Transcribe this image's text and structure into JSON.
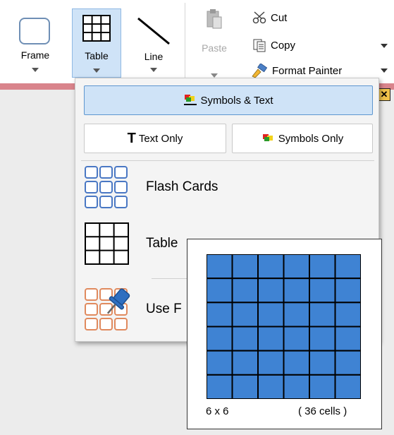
{
  "ribbon": {
    "frame_label": "Frame",
    "table_label": "Table",
    "line_label": "Line",
    "paste_label": "Paste",
    "cut_label": "Cut",
    "copy_label": "Copy",
    "format_painter_label": "Format Painter"
  },
  "menu": {
    "symbols_text_label": "Symbols & Text",
    "text_only_label": "Text Only",
    "symbols_only_label": "Symbols Only",
    "flash_cards_label": "Flash Cards",
    "table_label": "Table",
    "use_label": "Use F"
  },
  "preview": {
    "size_label": "6 x 6",
    "count_label": "( 36 cells )",
    "rows": 6,
    "cols": 6,
    "cell_color": "#3f83d3"
  },
  "colors": {
    "selected_bg": "#cfe3f7",
    "accent_border": "#5e96cf",
    "doc_bar": "#d9848c"
  }
}
